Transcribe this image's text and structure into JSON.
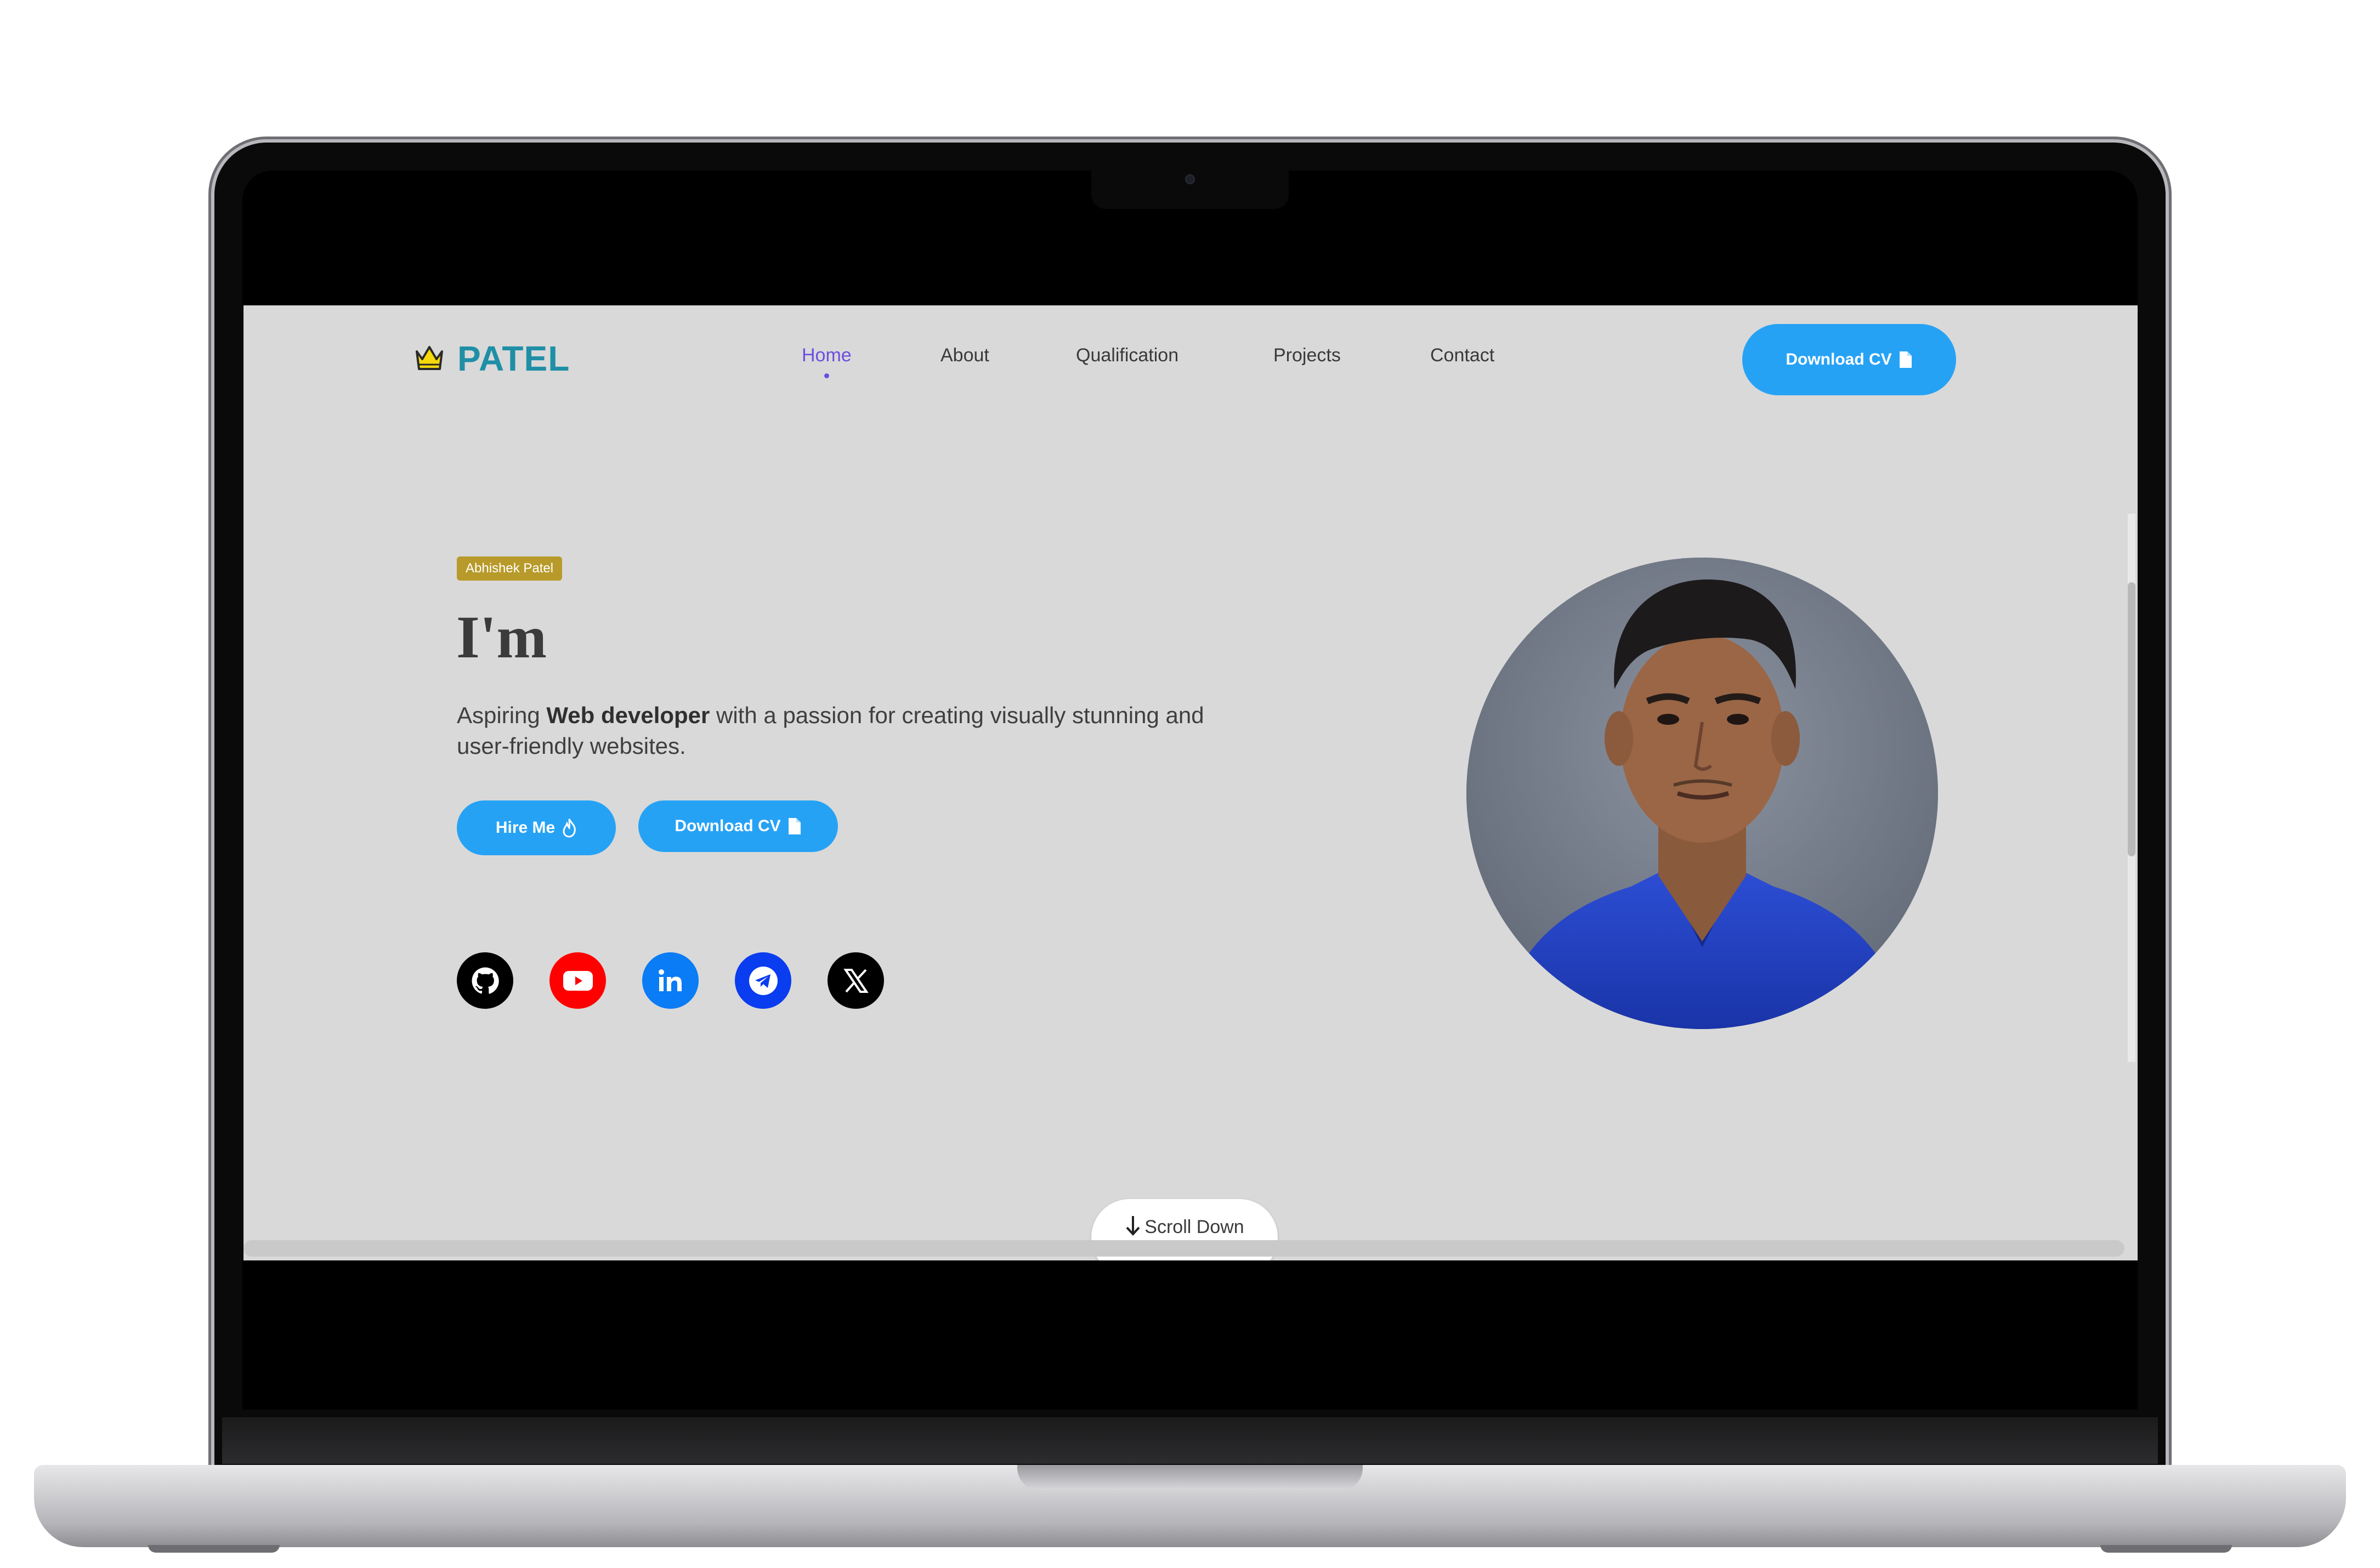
{
  "site": {
    "logo_text": "PATEL",
    "logo_icon": "crown-icon"
  },
  "nav": {
    "links": [
      {
        "label": "Home",
        "active": true
      },
      {
        "label": "About",
        "active": false
      },
      {
        "label": "Qualification",
        "active": false
      },
      {
        "label": "Projects",
        "active": false
      },
      {
        "label": "Contact",
        "active": false
      }
    ],
    "cv_button": {
      "label": "Download CV",
      "icon": "file-icon"
    }
  },
  "hero": {
    "tag": "Abhishek Patel",
    "title": "I'm",
    "desc_prefix": "Aspiring ",
    "desc_bold": "Web developer",
    "desc_suffix": " with a passion for creating visually stunning and user-friendly websites.",
    "hire_button": {
      "label": "Hire Me",
      "icon": "flame-icon"
    },
    "download_button": {
      "label": "Download CV",
      "icon": "file-icon"
    }
  },
  "socials": [
    {
      "name": "github",
      "icon": "github-icon",
      "color": "#000000"
    },
    {
      "name": "youtube",
      "icon": "youtube-icon",
      "color": "#ff0000"
    },
    {
      "name": "linkedin",
      "icon": "linkedin-icon",
      "color": "#0a7cf5"
    },
    {
      "name": "telegram",
      "icon": "telegram-icon",
      "color": "#0a3cf0"
    },
    {
      "name": "x",
      "icon": "x-icon",
      "color": "#000000"
    }
  ],
  "scroll": {
    "label": "Scroll Down",
    "icon": "arrow-down-icon"
  },
  "colors": {
    "accent": "#26a2f5",
    "nav_active": "#6c4ee0",
    "logo": "#1f8fa6",
    "tag_bg": "#b89a2a",
    "page_bg": "#d9d9d9"
  }
}
